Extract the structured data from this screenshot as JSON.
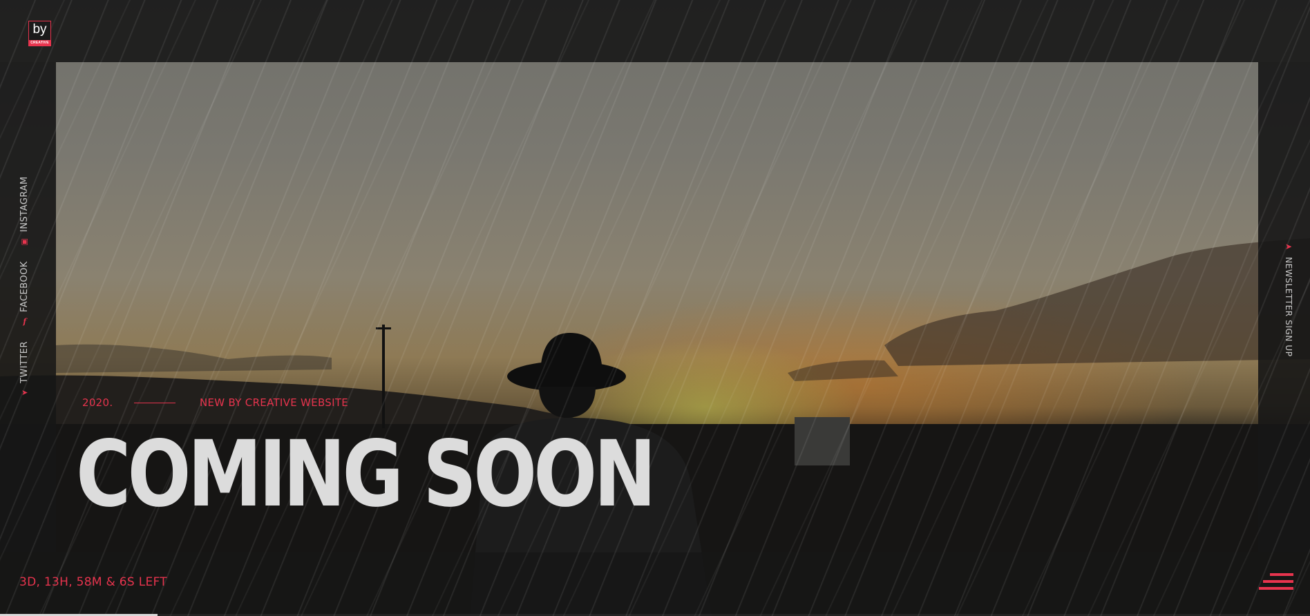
{
  "brand": {
    "logo_text": "by",
    "logo_subtext": "CREATIVE",
    "accent_color": "#e8344e"
  },
  "social": {
    "items": [
      {
        "label": "TWITTER",
        "icon": "twitter-icon"
      },
      {
        "label": "FACEBOOK",
        "icon": "facebook-icon"
      },
      {
        "label": "INSTAGRAM",
        "icon": "instagram-icon"
      }
    ]
  },
  "newsletter": {
    "label": "NEWSLETTER SIGN UP",
    "icon": "send-icon"
  },
  "hero": {
    "year": "2020.",
    "tagline": "NEW BY CREATIVE WEBSITE",
    "headline": "COMING SOON"
  },
  "countdown": {
    "text": "3D, 13H, 58M & 6S LEFT"
  },
  "menu": {
    "icon": "menu-icon"
  },
  "progress": {
    "fraction": 0.12
  }
}
